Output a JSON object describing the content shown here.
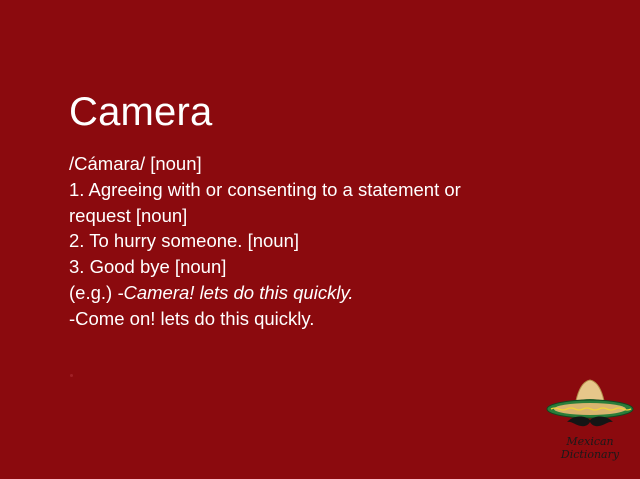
{
  "slide": {
    "title": "Camera",
    "lines": {
      "pronunciation": "/Cámara/ [noun]",
      "def1a": "1. Agreeing with or consenting to a statement or",
      "def1b": "request [noun]",
      "def2": "2. To hurry someone. [noun]",
      "def3": "3. Good bye [noun]",
      "example_prefix": "(e.g.) ",
      "example_italic": "-Camera! lets do this quickly.",
      "example_translation": "-Come on! lets do this quickly."
    }
  },
  "logo": {
    "icon": "sombrero-mustache-logo",
    "text": "Mexican Dictionary"
  },
  "colors": {
    "background": "#8b0a0e",
    "text": "#ffffff"
  }
}
